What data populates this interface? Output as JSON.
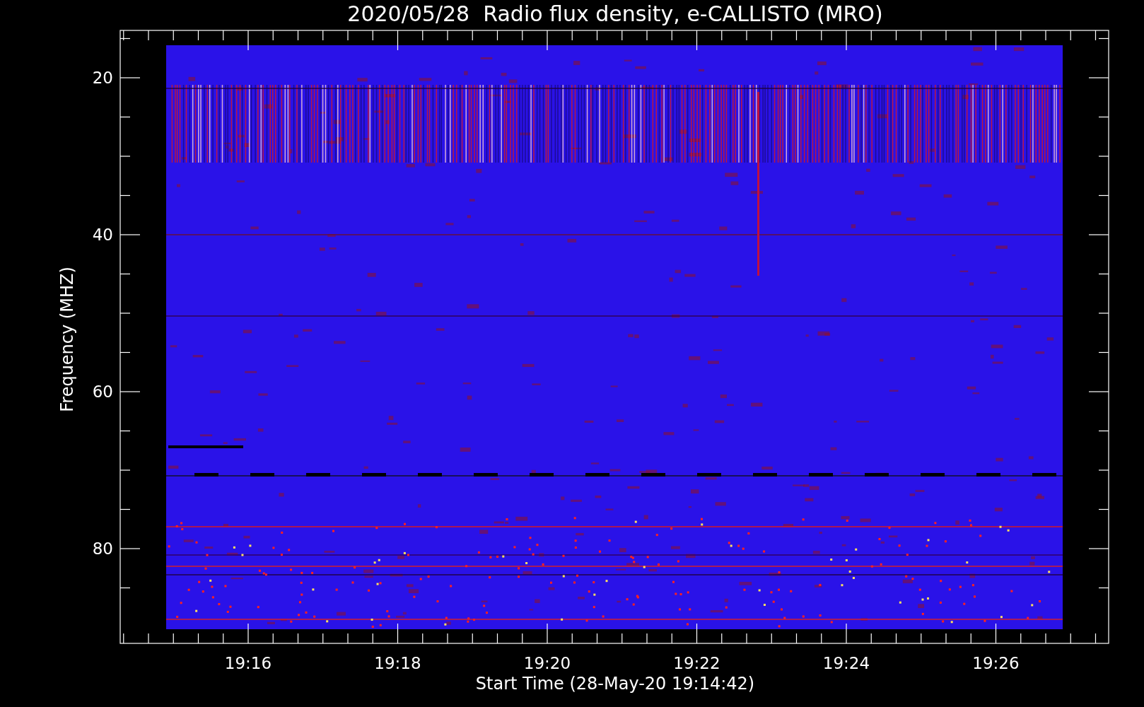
{
  "title": "2020/05/28  Radio flux density, e-CALLISTO (MRO)",
  "plot": {
    "ylabel": "Frequency (MHZ)",
    "xlabel": "Start Time (28-May-20 19:14:42)",
    "yticks": [
      "20",
      "40",
      "60",
      "80"
    ],
    "xticks": [
      "19:16",
      "19:18",
      "19:20",
      "19:22",
      "19:24",
      "19:26"
    ]
  }
}
